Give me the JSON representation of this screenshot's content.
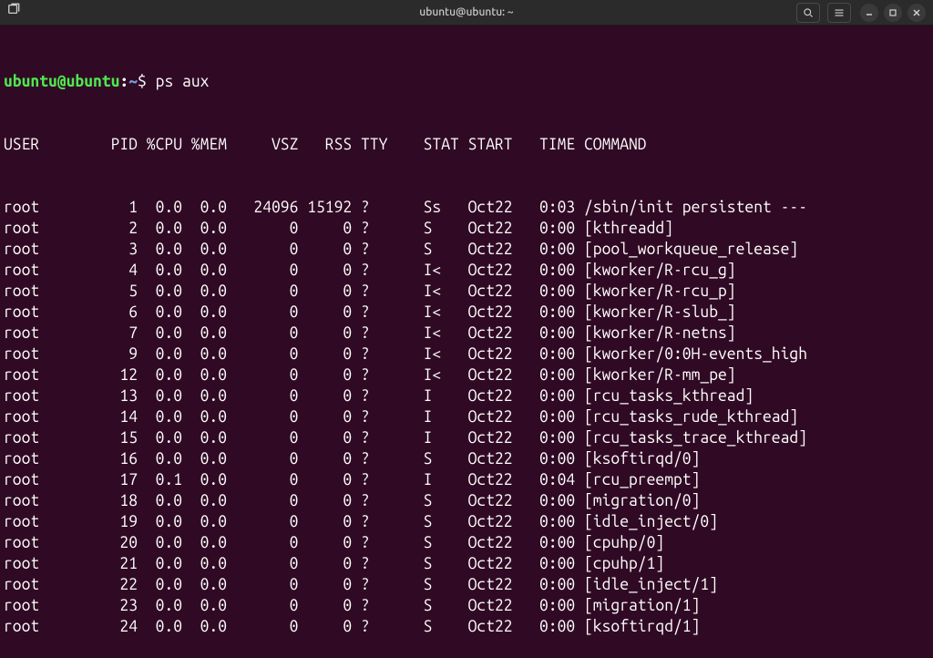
{
  "window": {
    "title": "ubuntu@ubuntu: ~"
  },
  "prompt": {
    "user_host": "ubuntu@ubuntu",
    "colon": ":",
    "path": "~",
    "symbol": "$ ",
    "command": "ps aux"
  },
  "columns": {
    "USER": {
      "width": 8,
      "align": "left"
    },
    "PID": {
      "width": 7,
      "align": "right"
    },
    "CPU": {
      "width": 5,
      "align": "right",
      "label": "%CPU"
    },
    "MEM": {
      "width": 5,
      "align": "right",
      "label": "%MEM"
    },
    "VSZ": {
      "width": 8,
      "align": "right"
    },
    "RSS": {
      "width": 6,
      "align": "right"
    },
    "TTY": {
      "width": 4,
      "align": "left"
    },
    "STAT": {
      "width": 8,
      "align": "right"
    },
    "START": {
      "width": 6,
      "align": "left"
    },
    "TIME": {
      "width": 8,
      "align": "right"
    },
    "COMMAND": {
      "width": 0,
      "align": "left"
    }
  },
  "header": [
    "USER",
    "PID",
    "%CPU",
    "%MEM",
    "VSZ",
    "RSS",
    "TTY",
    "STAT",
    "START",
    "TIME",
    "COMMAND"
  ],
  "rows": [
    {
      "USER": "root",
      "PID": "1",
      "CPU": "0.0",
      "MEM": "0.0",
      "VSZ": "24096",
      "RSS": "15192",
      "TTY": "?",
      "STAT": "Ss",
      "START": "Oct22",
      "TIME": "0:03",
      "COMMAND": "/sbin/init persistent ---"
    },
    {
      "USER": "root",
      "PID": "2",
      "CPU": "0.0",
      "MEM": "0.0",
      "VSZ": "0",
      "RSS": "0",
      "TTY": "?",
      "STAT": "S",
      "START": "Oct22",
      "TIME": "0:00",
      "COMMAND": "[kthreadd]"
    },
    {
      "USER": "root",
      "PID": "3",
      "CPU": "0.0",
      "MEM": "0.0",
      "VSZ": "0",
      "RSS": "0",
      "TTY": "?",
      "STAT": "S",
      "START": "Oct22",
      "TIME": "0:00",
      "COMMAND": "[pool_workqueue_release]"
    },
    {
      "USER": "root",
      "PID": "4",
      "CPU": "0.0",
      "MEM": "0.0",
      "VSZ": "0",
      "RSS": "0",
      "TTY": "?",
      "STAT": "I<",
      "START": "Oct22",
      "TIME": "0:00",
      "COMMAND": "[kworker/R-rcu_g]"
    },
    {
      "USER": "root",
      "PID": "5",
      "CPU": "0.0",
      "MEM": "0.0",
      "VSZ": "0",
      "RSS": "0",
      "TTY": "?",
      "STAT": "I<",
      "START": "Oct22",
      "TIME": "0:00",
      "COMMAND": "[kworker/R-rcu_p]"
    },
    {
      "USER": "root",
      "PID": "6",
      "CPU": "0.0",
      "MEM": "0.0",
      "VSZ": "0",
      "RSS": "0",
      "TTY": "?",
      "STAT": "I<",
      "START": "Oct22",
      "TIME": "0:00",
      "COMMAND": "[kworker/R-slub_]"
    },
    {
      "USER": "root",
      "PID": "7",
      "CPU": "0.0",
      "MEM": "0.0",
      "VSZ": "0",
      "RSS": "0",
      "TTY": "?",
      "STAT": "I<",
      "START": "Oct22",
      "TIME": "0:00",
      "COMMAND": "[kworker/R-netns]"
    },
    {
      "USER": "root",
      "PID": "9",
      "CPU": "0.0",
      "MEM": "0.0",
      "VSZ": "0",
      "RSS": "0",
      "TTY": "?",
      "STAT": "I<",
      "START": "Oct22",
      "TIME": "0:00",
      "COMMAND": "[kworker/0:0H-events_high"
    },
    {
      "USER": "root",
      "PID": "12",
      "CPU": "0.0",
      "MEM": "0.0",
      "VSZ": "0",
      "RSS": "0",
      "TTY": "?",
      "STAT": "I<",
      "START": "Oct22",
      "TIME": "0:00",
      "COMMAND": "[kworker/R-mm_pe]"
    },
    {
      "USER": "root",
      "PID": "13",
      "CPU": "0.0",
      "MEM": "0.0",
      "VSZ": "0",
      "RSS": "0",
      "TTY": "?",
      "STAT": "I",
      "START": "Oct22",
      "TIME": "0:00",
      "COMMAND": "[rcu_tasks_kthread]"
    },
    {
      "USER": "root",
      "PID": "14",
      "CPU": "0.0",
      "MEM": "0.0",
      "VSZ": "0",
      "RSS": "0",
      "TTY": "?",
      "STAT": "I",
      "START": "Oct22",
      "TIME": "0:00",
      "COMMAND": "[rcu_tasks_rude_kthread]"
    },
    {
      "USER": "root",
      "PID": "15",
      "CPU": "0.0",
      "MEM": "0.0",
      "VSZ": "0",
      "RSS": "0",
      "TTY": "?",
      "STAT": "I",
      "START": "Oct22",
      "TIME": "0:00",
      "COMMAND": "[rcu_tasks_trace_kthread]"
    },
    {
      "USER": "root",
      "PID": "16",
      "CPU": "0.0",
      "MEM": "0.0",
      "VSZ": "0",
      "RSS": "0",
      "TTY": "?",
      "STAT": "S",
      "START": "Oct22",
      "TIME": "0:00",
      "COMMAND": "[ksoftirqd/0]"
    },
    {
      "USER": "root",
      "PID": "17",
      "CPU": "0.1",
      "MEM": "0.0",
      "VSZ": "0",
      "RSS": "0",
      "TTY": "?",
      "STAT": "I",
      "START": "Oct22",
      "TIME": "0:04",
      "COMMAND": "[rcu_preempt]"
    },
    {
      "USER": "root",
      "PID": "18",
      "CPU": "0.0",
      "MEM": "0.0",
      "VSZ": "0",
      "RSS": "0",
      "TTY": "?",
      "STAT": "S",
      "START": "Oct22",
      "TIME": "0:00",
      "COMMAND": "[migration/0]"
    },
    {
      "USER": "root",
      "PID": "19",
      "CPU": "0.0",
      "MEM": "0.0",
      "VSZ": "0",
      "RSS": "0",
      "TTY": "?",
      "STAT": "S",
      "START": "Oct22",
      "TIME": "0:00",
      "COMMAND": "[idle_inject/0]"
    },
    {
      "USER": "root",
      "PID": "20",
      "CPU": "0.0",
      "MEM": "0.0",
      "VSZ": "0",
      "RSS": "0",
      "TTY": "?",
      "STAT": "S",
      "START": "Oct22",
      "TIME": "0:00",
      "COMMAND": "[cpuhp/0]"
    },
    {
      "USER": "root",
      "PID": "21",
      "CPU": "0.0",
      "MEM": "0.0",
      "VSZ": "0",
      "RSS": "0",
      "TTY": "?",
      "STAT": "S",
      "START": "Oct22",
      "TIME": "0:00",
      "COMMAND": "[cpuhp/1]"
    },
    {
      "USER": "root",
      "PID": "22",
      "CPU": "0.0",
      "MEM": "0.0",
      "VSZ": "0",
      "RSS": "0",
      "TTY": "?",
      "STAT": "S",
      "START": "Oct22",
      "TIME": "0:00",
      "COMMAND": "[idle_inject/1]"
    },
    {
      "USER": "root",
      "PID": "23",
      "CPU": "0.0",
      "MEM": "0.0",
      "VSZ": "0",
      "RSS": "0",
      "TTY": "?",
      "STAT": "S",
      "START": "Oct22",
      "TIME": "0:00",
      "COMMAND": "[migration/1]"
    },
    {
      "USER": "root",
      "PID": "24",
      "CPU": "0.0",
      "MEM": "0.0",
      "VSZ": "0",
      "RSS": "0",
      "TTY": "?",
      "STAT": "S",
      "START": "Oct22",
      "TIME": "0:00",
      "COMMAND": "[ksoftirqd/1]"
    }
  ]
}
